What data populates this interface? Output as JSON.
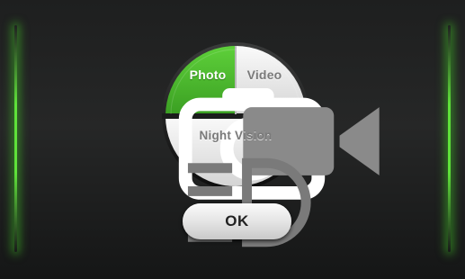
{
  "colors": {
    "accent_green": "#4bb82e",
    "glow_green": "#5fe23a",
    "background": "#1e1f1f",
    "panel_light": "#ededed",
    "label_gray": "#7a7a7a"
  },
  "mode_selector": {
    "selected": "photo",
    "options": [
      {
        "id": "photo",
        "label": "Photo",
        "icon": "camera-icon"
      },
      {
        "id": "video",
        "label": "Video",
        "icon": "video-camera-icon"
      },
      {
        "id": "night",
        "label": "Night Vision",
        "icon": "headlight-icon"
      }
    ]
  },
  "ok_button": {
    "label": "OK"
  }
}
